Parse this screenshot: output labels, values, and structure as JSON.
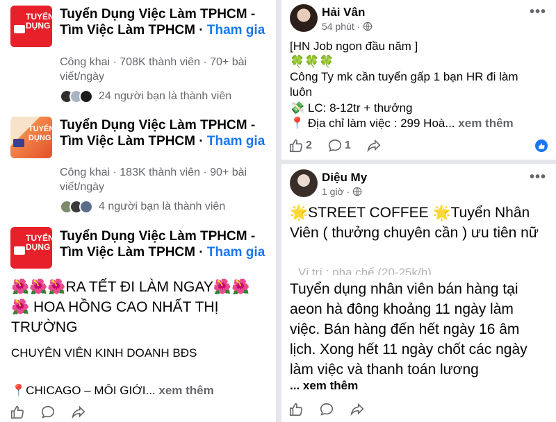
{
  "left": {
    "groups": [
      {
        "name": "Tuyển Dụng Việc Làm TPHCM - Tìm Việc Làm TPHCM · ",
        "join_label": "Tham gia",
        "meta": "Công khai · 708K thành viên · 70+ bài viết/ngày",
        "friends_text": "24 người bạn là thành viên",
        "logo_text": "TUYỂN DỤNG"
      },
      {
        "name": "Tuyển Dụng Việc Làm TPHCM - Tìm Việc Làm TPHCM · ",
        "join_label": "Tham gia",
        "meta": "Công khai · 183K thành viên · 90+ bài viết/ngày",
        "friends_text": "4 người bạn là thành viên",
        "logo_text": "TUYỂN DỤNG"
      },
      {
        "name": "Tuyển Dụng Việc Làm TPHCM - Tìm Việc Làm TPHCM · ",
        "join_label": "Tham gia",
        "logo_text": "TUYỂN DỤNG"
      }
    ],
    "post": {
      "line1": "🌺🌺🌺RA TẾT ĐI LÀM NGAY🌺🌺",
      "line2": "🌺 HOA HỒNG CAO NHẤT THỊ TRƯỜNG",
      "line3": "CHUYÊN VIÊN KINH DOANH BĐS",
      "line4": "📍CHICAGO – MÔI GIỚI...",
      "see_more": "xem thêm"
    }
  },
  "right": {
    "post1": {
      "author": "Hải Vân",
      "time": "54 phút ·",
      "menu": "•••",
      "lines": [
        "[HN Job ngon đầu năm ]",
        "🍀🍀🍀",
        "Công Ty mk cần tuyển gấp 1 bạn HR đi làm luôn",
        "💸 LC: 8-12tr + thưởng",
        "📍 Địa chỉ làm việc : 299 Hoà..."
      ],
      "see_more": "xem thêm",
      "like_count": "2",
      "comment_count": "1"
    },
    "post2": {
      "author": "Diệu My",
      "time": "1 giờ ·",
      "menu": "•••",
      "headline": "🌟STREET COFFEE 🌟Tuyển Nhân Viên ( thưởng chuyên cần ) ưu tiên nữ",
      "faded": "Vị trí : pha chế (20-25k/h)",
      "body": "Tuyển dụng nhân viên bán hàng tại aeon hà đông khoảng 11 ngày làm việc. Bán hàng đến hết ngày 16 âm lịch.  Xong hết 11 ngày chốt các ngày làm việc và thanh toán lương",
      "see_more": "... xem thêm"
    }
  },
  "colors": {
    "link_blue": "#1877f2",
    "meta_gray": "#65676b",
    "separator": "#e4e6eb",
    "logo_red": "#e8202a"
  },
  "icons": [
    "megaphone-icon",
    "like-icon",
    "comment-icon",
    "share-icon",
    "globe-icon",
    "more-icon",
    "like-reaction-icon"
  ]
}
